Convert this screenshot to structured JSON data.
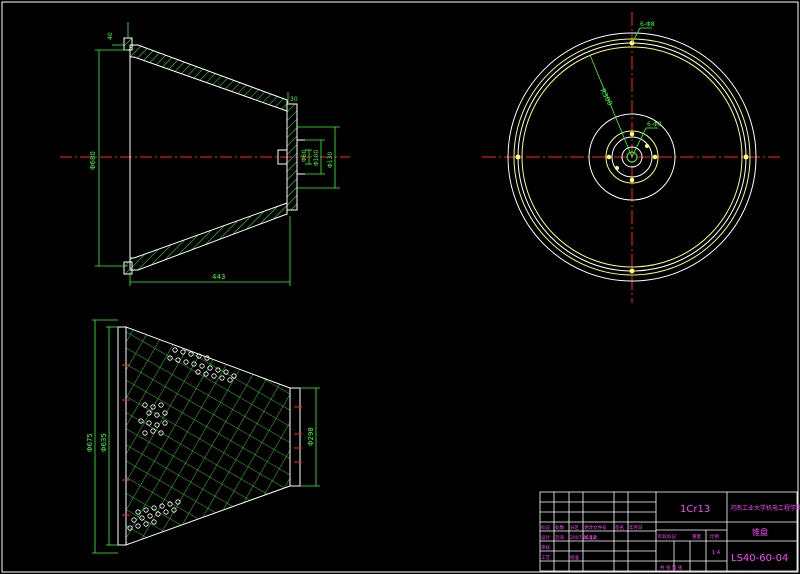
{
  "drawing": {
    "background": "#000000",
    "colors": {
      "frame": "#ffffff",
      "part": "#33ff33",
      "centerline": "#ff2222",
      "dimension": "#33ff33",
      "circle_outer": "#ffffff",
      "circle_yellow": "#ffff66",
      "holes": "#ffffff",
      "title_text": "#ff44ff"
    },
    "side_view": {
      "dimensions": {
        "top_flange": "40",
        "right_flange": "30",
        "height": "Φ680",
        "length": "443",
        "bore_a": "Φ60",
        "bore_b": "Φ100",
        "bore_c": "Φ130"
      }
    },
    "bottom_view": {
      "dimensions": {
        "outer": "Φ675",
        "inner": "Φ635",
        "small_end": "Φ298"
      }
    },
    "end_view": {
      "labels": {
        "radial_dim": "R300",
        "hole_note": "6-Φ8",
        "top_hole_note": "6-Φ8"
      }
    },
    "title_block": {
      "material": "1Cr13",
      "school": "河南工业大学机电工程学院",
      "part_name": "锥盘",
      "drawing_number": "LS40-60-04",
      "scale_label": "比例",
      "scale": "1:4",
      "weight_label": "重量",
      "sheet_label": "共  张  第  张",
      "rows": [
        [
          "标记",
          "处数",
          "分区",
          "更改文件号",
          "签名",
          "年月日"
        ],
        [
          "设计",
          "刘涛",
          "2007.06.12",
          "标准化",
          "",
          ""
        ],
        [
          "审核",
          "",
          "",
          "",
          "",
          ""
        ],
        [
          "工艺",
          "",
          "批准",
          "",
          "",
          ""
        ]
      ],
      "stage_label": "阶段标记"
    }
  }
}
